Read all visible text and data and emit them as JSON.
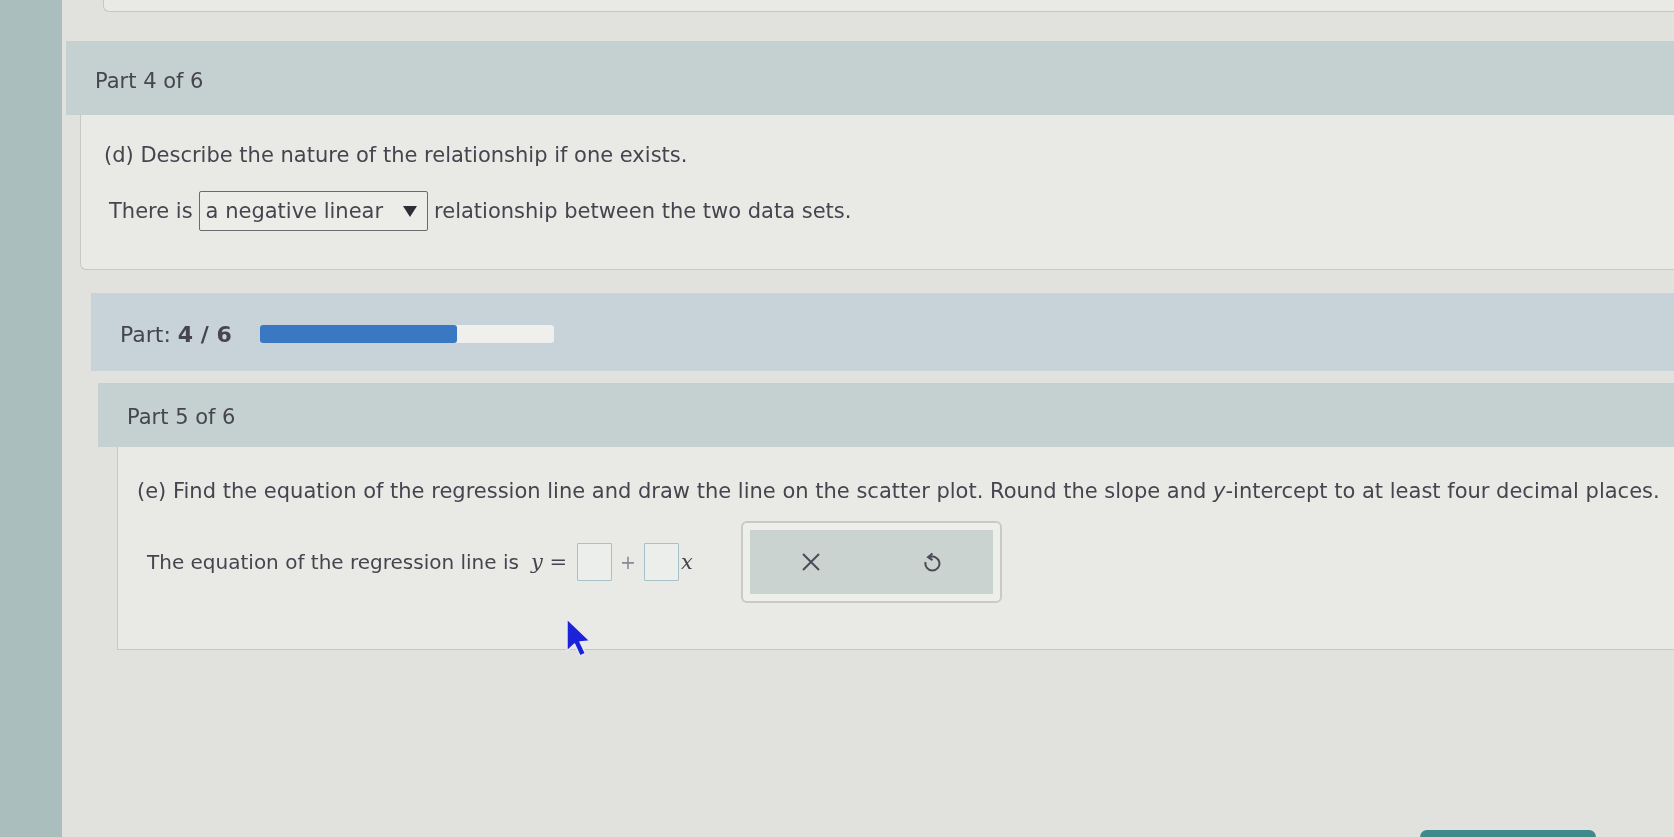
{
  "part_4": {
    "header": "Part 4 of 6",
    "prompt": "(d) Describe the nature of the relationship if one exists.",
    "sentence": {
      "before": "There is",
      "dropdown": {
        "value": "a negative linear"
      },
      "after": "relationship between the two data sets."
    }
  },
  "progress": {
    "label": "Part: **4 / 6**",
    "level": 0.67
  },
  "part_5": {
    "header": "Part 5 of 6",
    "prompt": "(e) Find the equation of the regression line and draw the line on the scatter plot. Round the slope and *y*-intercept to at least four decimal places.",
    "equation": {
      "lead": "The equation of the regression line is",
      "parts": [
        {
          "kind": "math",
          "text": "*y* ="
        },
        {
          "kind": "blank"
        },
        {
          "kind": "operator",
          "text": "+"
        },
        {
          "kind": "blank"
        },
        {
          "kind": "variable",
          "text": "x"
        }
      ]
    },
    "actions": [
      {
        "kind": "clear"
      },
      {
        "kind": "undo"
      }
    ]
  }
}
